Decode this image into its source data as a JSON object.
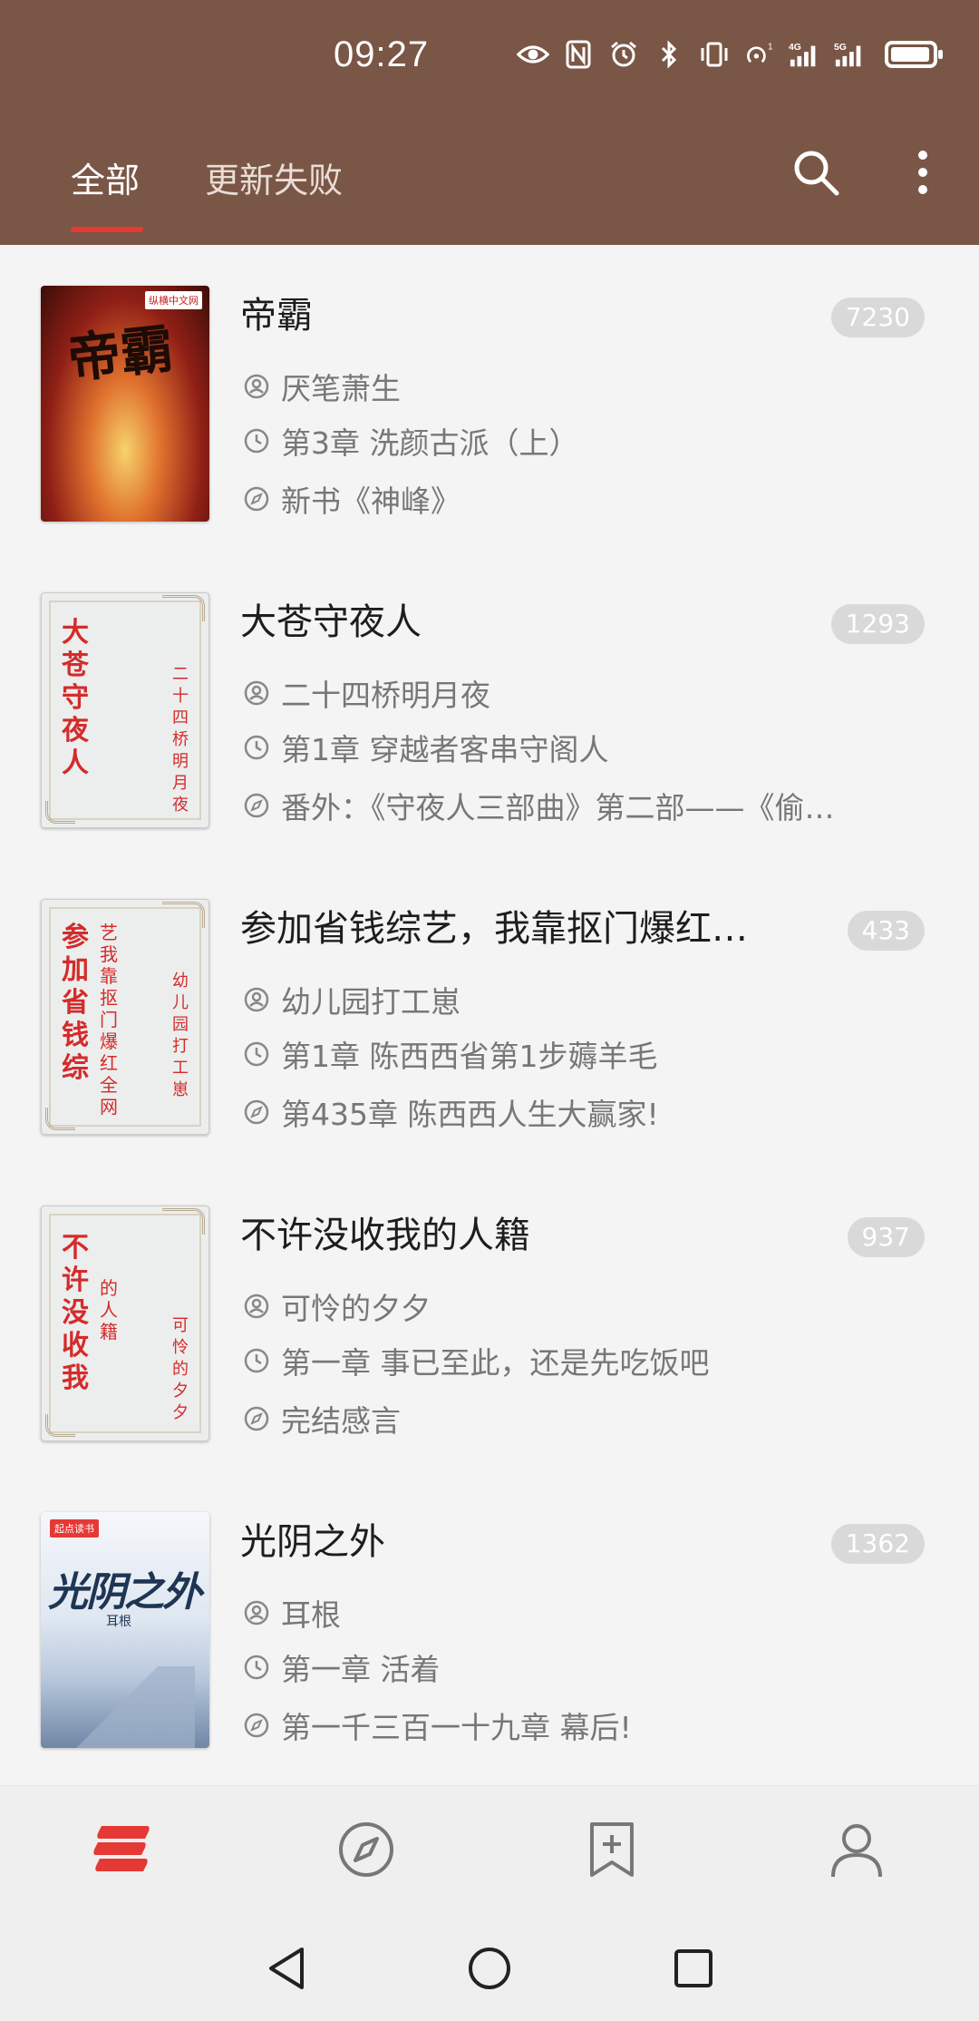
{
  "status_bar": {
    "time": "09:27",
    "icons": [
      "eye-icon",
      "nfc-icon",
      "alarm-icon",
      "bluetooth-icon",
      "vibrate-icon",
      "hotspot-icon",
      "signal-4g-icon",
      "signal-5g-icon",
      "battery-icon"
    ],
    "battery_level": 0.85
  },
  "header": {
    "tabs": [
      {
        "label": "全部",
        "active": true
      },
      {
        "label": "更新失败",
        "active": false
      }
    ],
    "search_icon": "search-icon",
    "more_icon": "more-vert-icon"
  },
  "books": [
    {
      "title": "帝霸",
      "count": "7230",
      "author": "厌笔萧生",
      "last_read": "第3章 洗颜古派（上）",
      "latest": "新书《神峰》",
      "cover": {
        "style": "dibai",
        "text": "帝霸"
      }
    },
    {
      "title": "大苍守夜人",
      "count": "1293",
      "author": "二十四桥明月夜",
      "last_read": "第1章 穿越者客串守阁人",
      "latest": "番外：《守夜人三部曲》第二部——《偷…",
      "cover": {
        "style": "classic",
        "text": "大苍守夜人",
        "author": "二十四桥明月夜"
      }
    },
    {
      "title": "参加省钱综艺，我靠抠门爆红…",
      "count": "433",
      "author": "幼儿园打工崽",
      "last_read": "第1章 陈西西省第1步薅羊毛",
      "latest": "第435章 陈西西人生大赢家!",
      "cover": {
        "style": "classic",
        "text": "参加省钱综",
        "sub": "艺我靠抠门爆红全网",
        "author": "幼儿园打工崽"
      }
    },
    {
      "title": "不许没收我的人籍",
      "count": "937",
      "author": "可怜的夕夕",
      "last_read": "第一章 事已至此，还是先吃饭吧",
      "latest": "完结感言",
      "cover": {
        "style": "classic",
        "text": "不许没收我",
        "sub": "的人籍",
        "author": "可怜的夕夕"
      }
    },
    {
      "title": "光阴之外",
      "count": "1362",
      "author": "耳根",
      "last_read": "第一章 活着",
      "latest": "第一千三百一十九章 幕后!",
      "cover": {
        "style": "guangyin",
        "text": "光阴之外",
        "author": "耳根",
        "logo": "起点读书"
      }
    }
  ],
  "bottom_nav": [
    {
      "name": "bookshelf-icon",
      "active": true
    },
    {
      "name": "explore-icon",
      "active": false
    },
    {
      "name": "rss-bookmark-icon",
      "active": false
    },
    {
      "name": "profile-icon",
      "active": false
    }
  ],
  "colors": {
    "header": "#7a5646",
    "accent": "#e53935",
    "badge": "#d9d9d9"
  }
}
